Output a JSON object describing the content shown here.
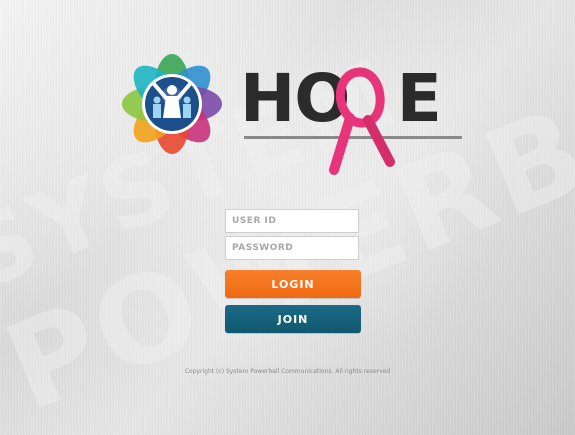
{
  "brand": {
    "name": "HOPE",
    "name_parts": [
      "HO",
      "P",
      "E"
    ],
    "ribbon_color": "#e8347a",
    "wordmark_color": "#2b2b2b",
    "emblem_icon": "people-circle-emblem-icon",
    "ribbon_icon": "awareness-ribbon-icon"
  },
  "watermark": {
    "line1": "SYSTEM",
    "line2": "POWERBALL"
  },
  "login_form": {
    "user_id_placeholder": "USER ID",
    "password_placeholder": "PASSWORD",
    "login_label": "LOGIN",
    "join_label": "JOIN",
    "login_color": "#f27415",
    "join_color": "#145f79"
  },
  "footer": {
    "copyright": "Copyright (c) System Powerball Communications. All rights reserved"
  }
}
